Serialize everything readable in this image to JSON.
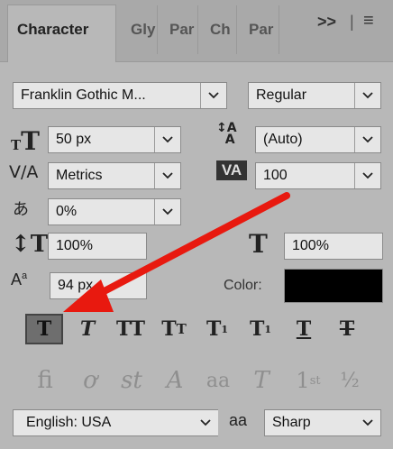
{
  "tabs": [
    {
      "label": "Character"
    },
    {
      "label": "Gly"
    },
    {
      "label": "Par"
    },
    {
      "label": "Ch"
    },
    {
      "label": "Par"
    }
  ],
  "tab_actions": {
    "expand_label": ">>",
    "menu_label": "≡"
  },
  "font": {
    "family": "Franklin Gothic M...",
    "style": "Regular"
  },
  "size": {
    "font_size": "50 px",
    "leading": "(Auto)"
  },
  "spacing": {
    "kerning": "Metrics",
    "tracking": "100",
    "tsume": "0%"
  },
  "scale": {
    "vertical": "100%",
    "horizontal": "100%"
  },
  "baseline": {
    "shift": "94 px"
  },
  "color": {
    "label": "Color:",
    "value": "#000000"
  },
  "style_buttons": [
    "Faux Bold",
    "Faux Italic",
    "All Caps",
    "Small Caps",
    "Superscript",
    "Subscript",
    "Underline",
    "Strikethrough"
  ],
  "opentype_buttons": [
    "Ligatures",
    "Old Style",
    "Swash",
    "Contextual Alternates",
    "Discretionary Ligatures",
    "Titling",
    "Ordinals",
    "Fractions"
  ],
  "language": {
    "value": "English: USA"
  },
  "antialias": {
    "icon_label": "aa",
    "value": "Sharp"
  },
  "annotation": {
    "arrow_color": "#e8190f"
  }
}
